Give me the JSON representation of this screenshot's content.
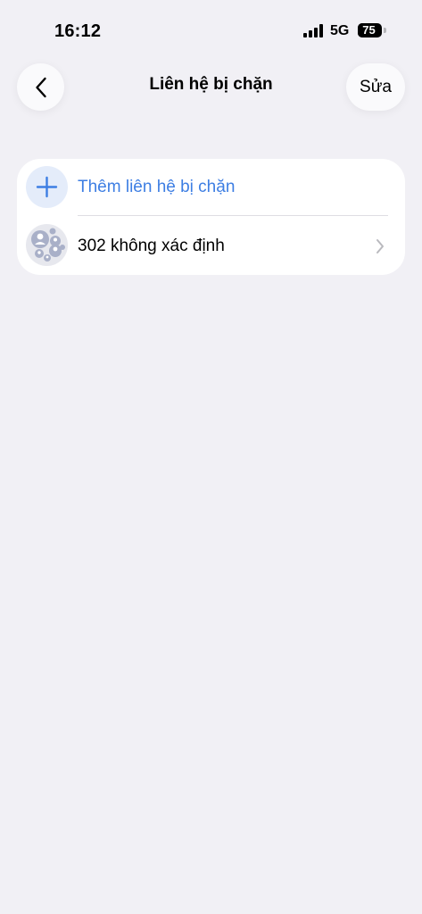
{
  "status_bar": {
    "time": "16:12",
    "network": "5G",
    "battery": "75",
    "battery_fraction": 0.75
  },
  "nav": {
    "back_icon": "chevron-left-icon",
    "title": "Liên hệ bị chặn",
    "edit_label": "Sửa"
  },
  "list": {
    "add_row": {
      "icon": "plus-icon",
      "label": "Thêm liên hệ bị chặn"
    },
    "items": [
      {
        "icon": "contact-group-avatar",
        "label": "302 không xác định",
        "trailing_icon": "chevron-right-icon"
      }
    ]
  },
  "colors": {
    "background": "#f1f0f5",
    "card": "#ffffff",
    "accent": "#3d7ee3",
    "add_circle_bg": "#e4ecfa",
    "chevron": "#b9b9be"
  }
}
